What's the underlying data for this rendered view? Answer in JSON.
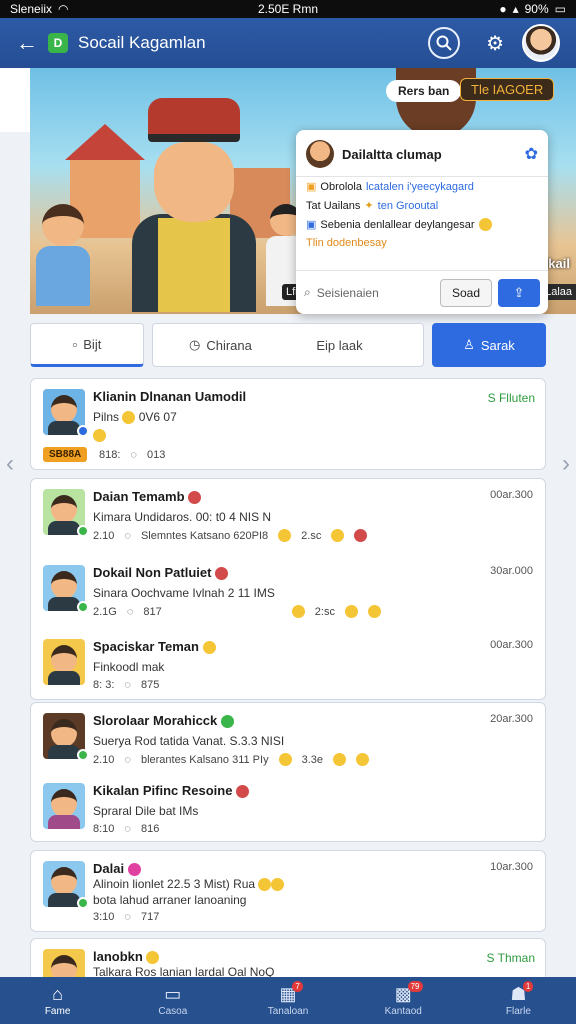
{
  "status": {
    "carrier": "Sleneiix",
    "time": "2.50E Rmn",
    "battery": "90%"
  },
  "appbar": {
    "logo_letter": "D",
    "title": "Socail Kagamlan"
  },
  "banner": {
    "bubble": "Rers ban",
    "tag": "Tle IAGOER",
    "side_text": "Ekail",
    "lc_label": "Lfiene",
    "side_label": "Lalaa"
  },
  "popup": {
    "title": "Dailaltta clumap",
    "lines": [
      {
        "a": "Obrolola",
        "b": "lcatalen i'yeecykagard"
      },
      {
        "a": "Tat Uailans",
        "b": "ten Grooutal"
      },
      {
        "a": "Sebenia denlallear deylangesar",
        "b": ""
      },
      {
        "a": "Tlin dodenbesay",
        "b": ""
      }
    ],
    "search_placeholder": "Seisienaien",
    "search_button": "Soad"
  },
  "tabs": [
    {
      "label": "Bijt"
    },
    {
      "label": "Chirana"
    },
    {
      "label": "Eip laak"
    },
    {
      "label": "Sarak"
    }
  ],
  "posts": {
    "p1": {
      "name": "Klianin Dlnanan Uamodil",
      "status": "S Flluten",
      "sub": "Pilns",
      "sub2": "0V6 07",
      "pill": "SB88A",
      "count1": "818:",
      "count2": "013"
    },
    "p2": {
      "name": "Daian Temamb",
      "time": "00ar.300",
      "sub": "Kimara Undidaros. 00: t0 4 NIS N",
      "m1": "2.10",
      "m2": "Slemntes Katsano 620PI8",
      "m3": "2.sc"
    },
    "p3": {
      "name": "Dokail Non Patluiet",
      "time": "30ar.000",
      "sub": "Sinara Oochvame Ivlnah 2 11 IMS",
      "m1": "2.1G",
      "m2": "817",
      "m3": "2:sc"
    },
    "p4": {
      "name": "Spaciskar Teman",
      "time": "00ar.300",
      "sub": "Finkoodl mak",
      "m1": "8: 3:",
      "m2": "875"
    },
    "p5": {
      "name": "Slorolaar Morahicck",
      "time": "20ar.300",
      "sub": "Suerya Rod tatida Vanat. S.3.3 NISI",
      "m1": "2.10",
      "m2": "blerantes Kalsano 311 PIy",
      "m3": "3.3e"
    },
    "p6": {
      "name": "Kikalan Pifinc Resoine",
      "sub": "Spraral Dile bat IMs",
      "m1": "8:10",
      "m2": "816"
    },
    "p7": {
      "name": "Dalai",
      "time": "10ar.300",
      "sub": "Alinoin lionlet 22.5 3 Mist) Rua",
      "sub2": "bota lahud arraner lanoaning",
      "m1": "3:10",
      "m2": "717"
    },
    "p8": {
      "name": "lanobkn",
      "status": "S Thman",
      "sub": "Talkara Ros lanian lardal Oal NoQ"
    }
  },
  "nav": [
    {
      "label": "Fame",
      "badge": ""
    },
    {
      "label": "Casoa",
      "badge": ""
    },
    {
      "label": "Tanaloan",
      "badge": "7"
    },
    {
      "label": "Kantaod",
      "badge": "79"
    },
    {
      "label": "Flarle",
      "badge": "1"
    }
  ]
}
